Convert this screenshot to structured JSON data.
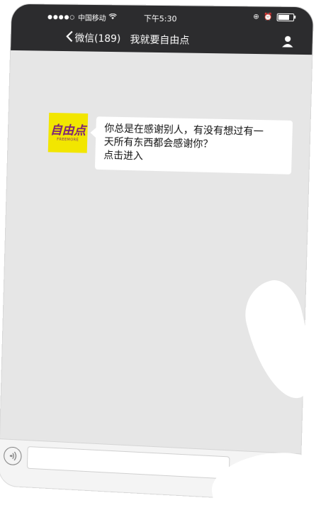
{
  "status_bar": {
    "carrier": "中国移动",
    "time": "下午5:30"
  },
  "nav": {
    "back_label": "微信(189)",
    "title": "我就要自由点"
  },
  "message": {
    "avatar_logo_text": "自由点",
    "avatar_logo_sub": "FREEMORE",
    "lines": [
      "你总是在感谢别人，有没有想过有一",
      "天所有东西都会感谢你？",
      "点击进入"
    ]
  },
  "input_bar": {
    "placeholder": ""
  },
  "colors": {
    "top_bar": "#2c2c2e",
    "chat_background": "#e6e6e6",
    "avatar_yellow": "#f2e600",
    "logo_purple": "#7a1f7a"
  },
  "icons": {
    "back": "chevron-left-icon",
    "profile": "person-icon",
    "voice": "voice-icon",
    "emoji": "emoji-icon",
    "more": "plus-icon",
    "wifi": "wifi-icon",
    "alarm": "alarm-icon",
    "battery": "battery-icon"
  }
}
